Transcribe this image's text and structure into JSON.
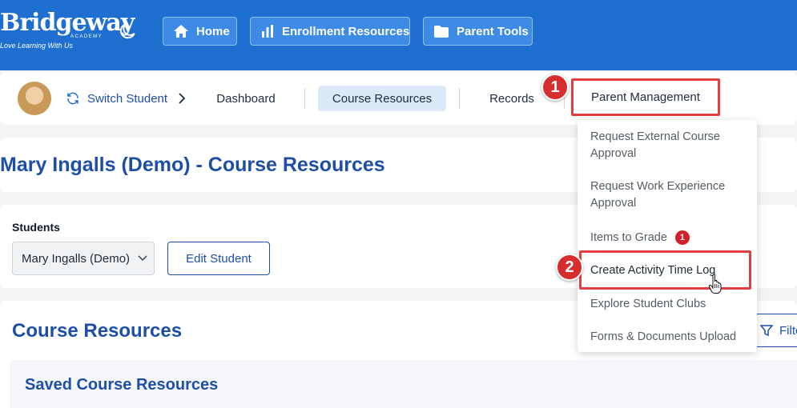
{
  "brand": {
    "name": "Bridgeway",
    "sub": "ACADEMY",
    "tagline": "Love Learning With Us"
  },
  "topnav": [
    {
      "label": "Home",
      "icon": "home-icon"
    },
    {
      "label": "Enrollment Resources",
      "icon": "bar-chart-icon"
    },
    {
      "label": "Parent Tools",
      "icon": "folder-icon"
    }
  ],
  "subnav": {
    "switch_label": "Switch Student",
    "tabs": [
      "Dashboard",
      "Course Resources",
      "Records",
      "Parent Management"
    ],
    "active_tab": "Course Resources"
  },
  "page": {
    "title": "Mary Ingalls (Demo) - Course Resources"
  },
  "students": {
    "label": "Students",
    "selected": "Mary Ingalls (Demo)",
    "edit_label": "Edit Student"
  },
  "course": {
    "title": "Course Resources",
    "filter_label": "Filte",
    "saved_title": "Saved Course Resources"
  },
  "dropdown": {
    "items": [
      "Request External Course Approval",
      "Request Work Experience Approval",
      "Items to Grade",
      "Create Activity Time Log",
      "Explore Student Clubs",
      "Forms & Documents Upload"
    ],
    "items_to_grade_badge": "1"
  },
  "steps": [
    "1",
    "2"
  ],
  "colors": {
    "header_blue": "#1e6fd0",
    "title_blue": "#1e4fa8",
    "highlight_red": "#e53e3e"
  }
}
